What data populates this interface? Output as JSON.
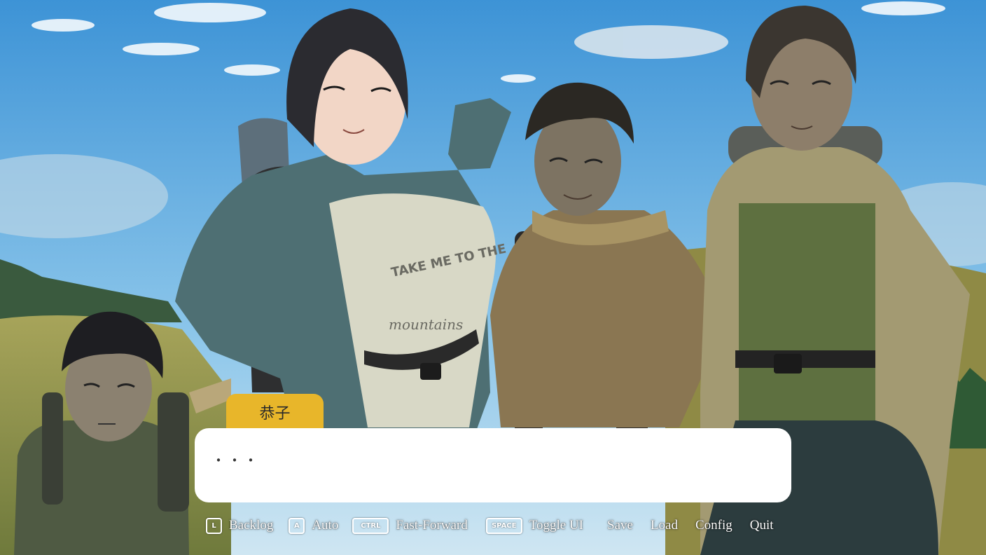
{
  "speaker": "恭子",
  "dialogue_text": "・・・",
  "menu": [
    {
      "key": "L",
      "label": "Backlog"
    },
    {
      "key": "A",
      "label": "Auto"
    },
    {
      "key": "CTRL",
      "label": "Fast-Forward"
    },
    {
      "key": "SPACE",
      "label": "Toggle UI"
    },
    {
      "key": "",
      "label": "Save"
    },
    {
      "key": "",
      "label": "Load"
    },
    {
      "key": "",
      "label": "Config"
    },
    {
      "key": "",
      "label": "Quit"
    }
  ],
  "colors": {
    "nametag": "#e8b62a",
    "sky": "#5aa7dc",
    "dialogue_box": "#ffffff"
  }
}
